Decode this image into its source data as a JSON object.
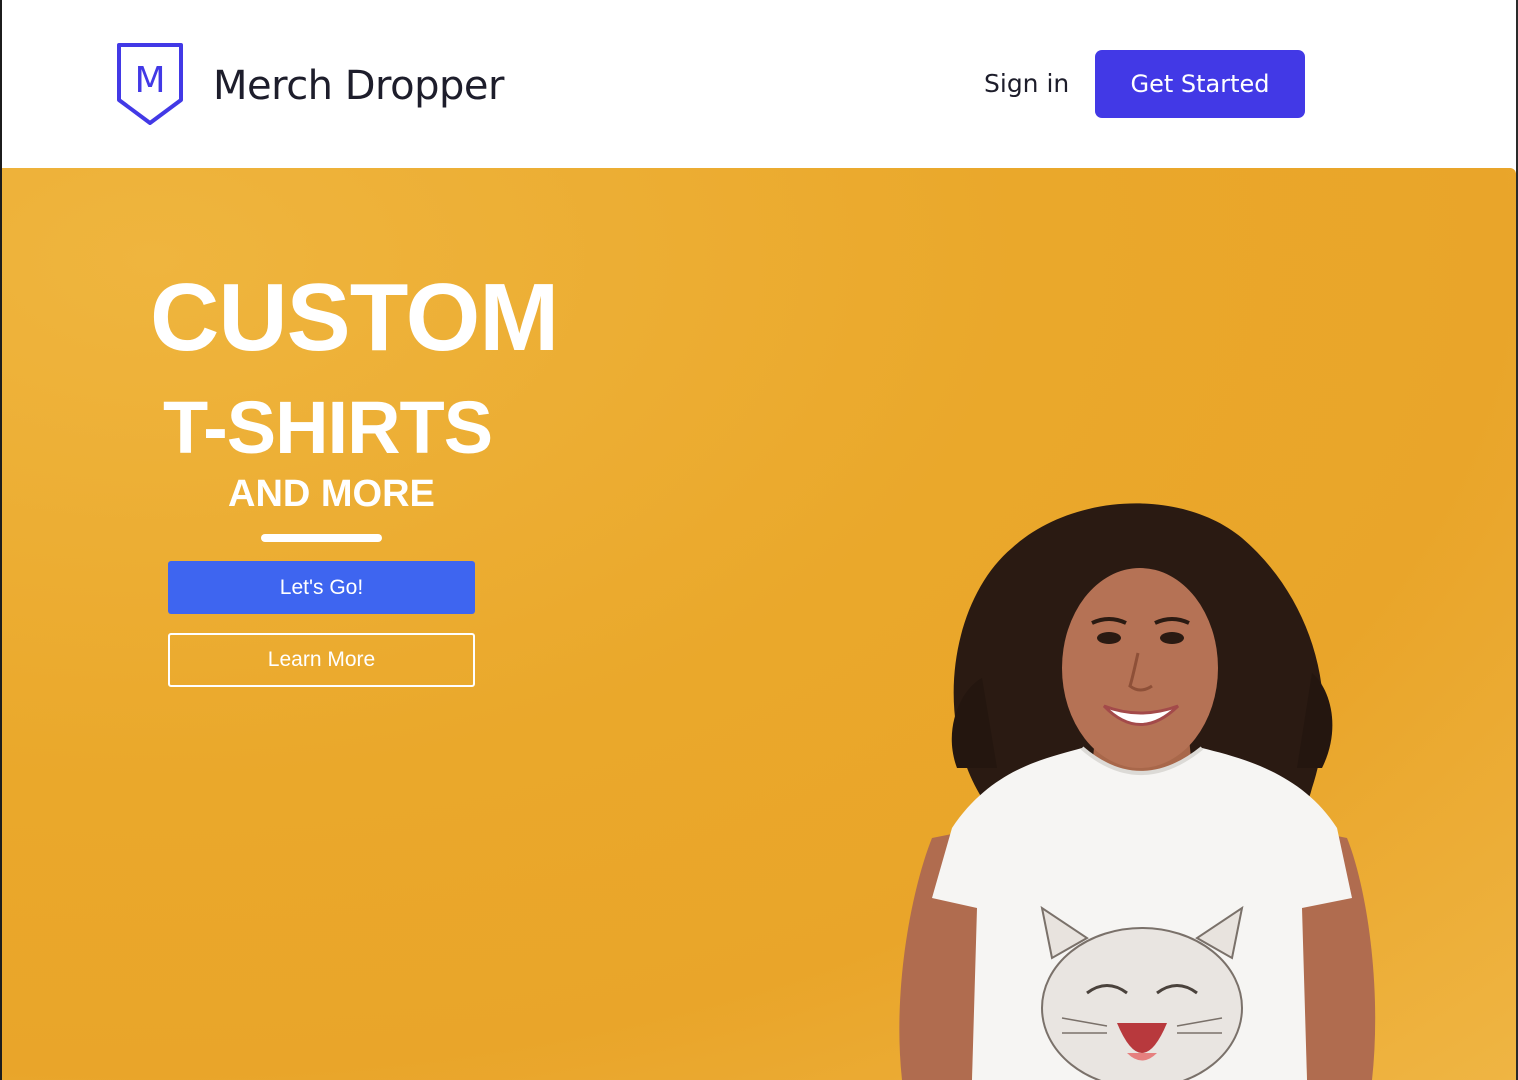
{
  "header": {
    "logo_letter": "M",
    "brand_name": "Merch Dropper",
    "signin_label": "Sign in",
    "get_started_label": "Get Started"
  },
  "hero": {
    "line1": "CUSTOM",
    "line2": "T-SHIRTS",
    "line3": "AND MORE",
    "primary_cta": "Let's Go!",
    "secondary_cta": "Learn More"
  },
  "colors": {
    "brand_purple": "#4239e6",
    "cta_blue": "#3e65f0",
    "hero_yellow": "#e9a52a",
    "text_dark": "#1d1d2b"
  }
}
